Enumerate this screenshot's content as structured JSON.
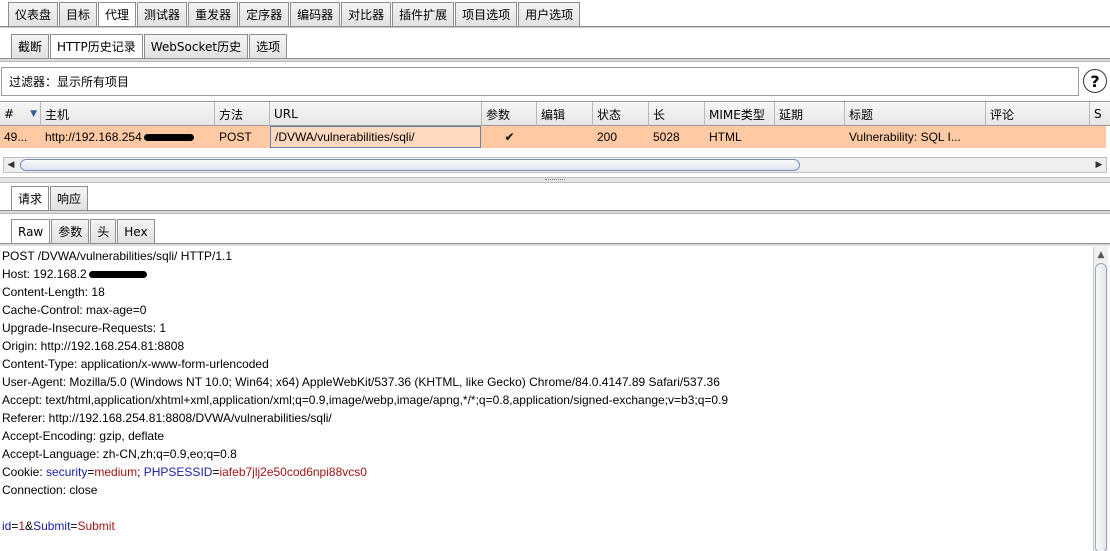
{
  "top_tabs": [
    "仪表盘",
    "目标",
    "代理",
    "测试器",
    "重发器",
    "定序器",
    "编码器",
    "对比器",
    "插件扩展",
    "项目选项",
    "用户选项"
  ],
  "top_active": "代理",
  "sub_tabs": [
    "截断",
    "HTTP历史记录",
    "WebSocket历史",
    "选项"
  ],
  "sub_active": "HTTP历史记录",
  "filter": {
    "text": "过滤器：显示所有项目",
    "help": "?"
  },
  "table": {
    "headers": {
      "num": "#",
      "host": "主机",
      "method": "方法",
      "url": "URL",
      "params": "参数",
      "edited": "编辑",
      "status": "状态",
      "length": "长",
      "mime": "MIME类型",
      "ext": "延期",
      "title": "标题",
      "comment": "评论",
      "s": "S"
    },
    "row": {
      "num": "49...",
      "host": "http://192.168.254",
      "method": "POST",
      "url": "/DVWA/vulnerabilities/sqli/",
      "params": "✔",
      "status": "200",
      "length": "5028",
      "mime": "HTML",
      "title": "Vulnerability: SQL I..."
    },
    "row_color": "#ffc9a3"
  },
  "req_tabs": [
    "请求",
    "响应"
  ],
  "req_active": "请求",
  "view_tabs": [
    "Raw",
    "参数",
    "头",
    "Hex"
  ],
  "view_active": "Raw",
  "request": {
    "lines": [
      "POST /DVWA/vulnerabilities/sqli/ HTTP/1.1",
      "Host: 192.168.2",
      "Content-Length: 18",
      "Cache-Control: max-age=0",
      "Upgrade-Insecure-Requests: 1",
      "Origin: http://192.168.254.81:8808",
      "Content-Type: application/x-www-form-urlencoded",
      "User-Agent: Mozilla/5.0 (Windows NT 10.0; Win64; x64) AppleWebKit/537.36 (KHTML, like Gecko) Chrome/84.0.4147.89 Safari/537.36",
      "Accept: text/html,application/xhtml+xml,application/xml;q=0.9,image/webp,image/apng,*/*;q=0.8,application/signed-exchange;v=b3;q=0.9",
      "Referer: http://192.168.254.81:8808/DVWA/vulnerabilities/sqli/",
      "Accept-Encoding: gzip, deflate",
      "Accept-Language: zh-CN,zh;q=0.9,eo;q=0.8"
    ],
    "cookie": {
      "prefix": "Cookie: ",
      "k1": "security",
      "eq1": "=",
      "v1": "medium",
      "sep": "; ",
      "k2": "PHPSESSID",
      "eq2": "=",
      "v2": "iafeb7jlj2e50cod6npi88vcs0"
    },
    "connection": "Connection: close",
    "body": {
      "k1": "id",
      "eq1": "=",
      "v1": "1",
      "amp": "&",
      "k2": "Submit",
      "eq2": "=",
      "v2": "Submit"
    }
  }
}
